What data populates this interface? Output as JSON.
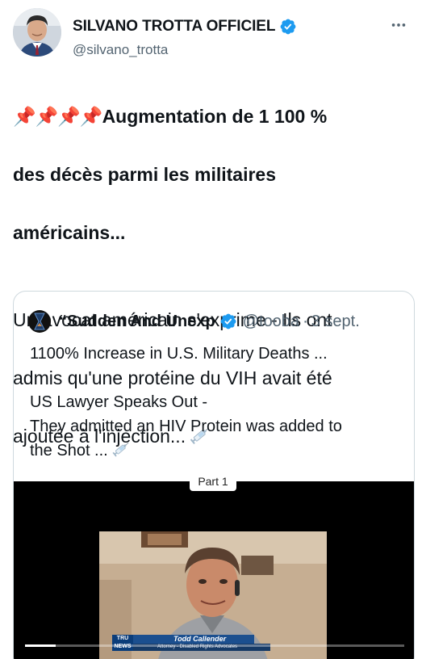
{
  "author": {
    "display_name": "SILVANO TROTTA OFFICIEL",
    "handle": "@silvano_trotta",
    "verified_color": "#1d9bf0"
  },
  "tweet": {
    "pins": "📌📌📌📌",
    "line1": "Augmentation de 1 100 %",
    "line2": "des décès parmi les militaires",
    "line3": "américains...",
    "line4": "Un avocat américain s'exprime - Ils ont",
    "line5": "admis qu'une protéine du VIH avait été",
    "line6": "ajoutée à l'injection..."
  },
  "quote": {
    "name": "“Sudden And Unexp",
    "handle": "@tooba",
    "separator": "·",
    "date": "3 sept.",
    "line1": "1100% Increase in U.S. Military Deaths ...",
    "line2": "US Lawyer Speaks Out -",
    "line3": "They admitted an HIV Protein was added to",
    "line4": "the Shot ..."
  },
  "video": {
    "part_label": "Part 1",
    "lower_third_logo": "TRU NEWS",
    "lower_third_name": "Todd Callender",
    "lower_third_title": "Attorney - Disabled Rights Advocates",
    "progress_fraction": 0.08
  },
  "icons": {
    "more": "more-icon",
    "verified": "verified-badge-icon",
    "syringe": "syringe-icon"
  }
}
